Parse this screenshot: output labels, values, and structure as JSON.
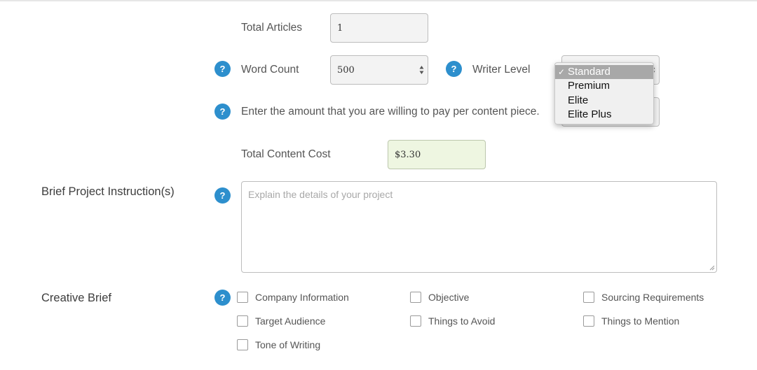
{
  "total_articles": {
    "label": "Total Articles",
    "value": "1"
  },
  "word_count": {
    "label": "Word Count",
    "value": "500",
    "help": "?"
  },
  "writer_level": {
    "label": "Writer Level",
    "help": "?",
    "options": [
      "Standard",
      "Premium",
      "Elite",
      "Elite Plus"
    ],
    "selected": "Standard",
    "check_mark": "✓"
  },
  "pay_per_piece": {
    "label": "Enter the amount that you are willing to pay per content piece.",
    "help": "?"
  },
  "total_cost": {
    "label": "Total Content Cost",
    "value": "$3.30"
  },
  "project_instructions": {
    "label": "Brief Project Instruction(s)",
    "help": "?",
    "placeholder": "Explain the details of your project"
  },
  "creative_brief": {
    "label": "Creative Brief",
    "help": "?",
    "options": [
      "Company Information",
      "Objective",
      "Sourcing Requirements",
      "Target Audience",
      "Things to Avoid",
      "Things to Mention",
      "Tone of Writing"
    ]
  },
  "colors": {
    "help_icon": "#2d8fcd",
    "cost_field_bg": "#eef6e1",
    "dropdown_selected": "#a8a8a8"
  }
}
